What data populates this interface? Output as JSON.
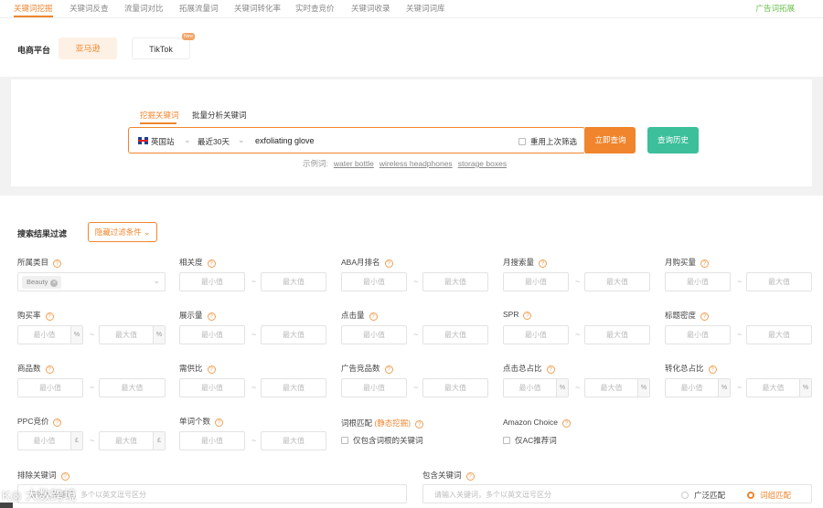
{
  "topnav": {
    "tabs": [
      "关键词挖掘",
      "关键词反查",
      "流量词对比",
      "拓展流量词",
      "关键词转化率",
      "实时查竞价",
      "关键词收录",
      "关键词词库"
    ],
    "active_index": 0,
    "ad_link": "广告词拓展"
  },
  "platform": {
    "label": "电商平台",
    "amazon": "亚马逊",
    "tiktok": "TikTok",
    "new_badge": "New"
  },
  "search": {
    "tabs": [
      "挖掘关键词",
      "批量分析关键词"
    ],
    "site": "英国站",
    "range": "最近30天",
    "keyword": "exfoliating glove",
    "reuse_label": "重用上次筛选",
    "query_button": "立即查询",
    "history_button": "查询历史",
    "example_label": "示例词:",
    "examples": [
      "water bottle",
      "wireless headphones",
      "storage boxes"
    ]
  },
  "filters": {
    "title": "搜索结果过滤",
    "hide_button": "隐藏过滤条件",
    "min_ph": "最小值",
    "max_ph": "最大值",
    "dash": "~",
    "percent": "%",
    "currency": "£",
    "category_label": "所属类目",
    "category_chip": "Beauty",
    "labels": {
      "relevance": "相关度",
      "aba_rank": "ABA月排名",
      "monthly_search": "月搜索量",
      "monthly_purchase": "月购买量",
      "purchase_rate": "购买率",
      "impressions": "展示量",
      "clicks": "点击量",
      "spr": "SPR",
      "title_density": "标题密度",
      "product_count": "商品数",
      "supply_demand": "需供比",
      "ad_competitors": "广告竞品数",
      "click_share": "点击总占比",
      "conversion_share": "转化总占比",
      "ppc_bid": "PPC竞价",
      "word_count": "单词个数",
      "root_match": "词根匹配",
      "root_match_tag": "(静态挖掘)",
      "amazon_choice": "Amazon Choice"
    },
    "root_only": "仅包含词根的关键词",
    "ac_only": "仅AC推荐词",
    "exclude_label": "排除关键词",
    "exclude_placeholder": "请输入关键词，多个以英文逗号区分",
    "include_label": "包含关键词",
    "include_placeholder": "请输入关键词，多个以英文逗号区分",
    "broad_match": "广泛匹配",
    "phrase_match": "词组匹配"
  },
  "watermark": "大数跨境",
  "colors": {
    "accent": "#f0852d",
    "history": "#3cbf9a",
    "ad_link": "#6bbf4e"
  }
}
